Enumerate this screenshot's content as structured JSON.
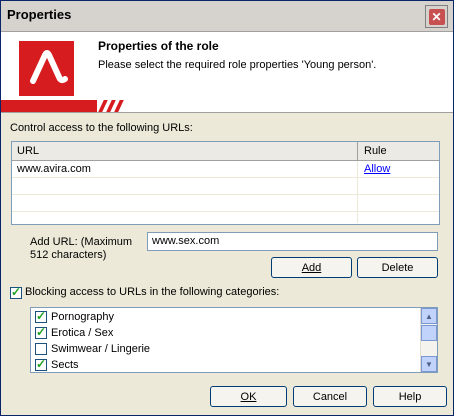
{
  "window": {
    "title": "Properties"
  },
  "header": {
    "title": "Properties of the role",
    "subtitle": "Please select the required role properties 'Young person'."
  },
  "urls": {
    "section_label": "Control access to the following URLs:",
    "columns": {
      "url": "URL",
      "rule": "Rule"
    },
    "rows": [
      {
        "url": "www.avira.com",
        "rule": "Allow"
      }
    ]
  },
  "add_url": {
    "label_line1": "Add URL: (Maximum",
    "label_line2": "512 characters)",
    "value": "www.sex.com"
  },
  "buttons": {
    "add": "Add",
    "delete": "Delete",
    "ok": "OK",
    "cancel": "Cancel",
    "help": "Help"
  },
  "categories": {
    "checkbox_label": "Blocking access to URLs in the following categories:",
    "checked": true,
    "items": [
      {
        "label": "Pornography",
        "checked": true
      },
      {
        "label": "Erotica / Sex",
        "checked": true
      },
      {
        "label": "Swimwear / Lingerie",
        "checked": false
      },
      {
        "label": "Sects",
        "checked": true
      }
    ]
  },
  "colors": {
    "brand_red": "#d61c1f",
    "link": "#0000ff",
    "check": "#21a121"
  },
  "icons": {
    "logo": "avira-umbrella-logo",
    "close": "close-icon"
  }
}
